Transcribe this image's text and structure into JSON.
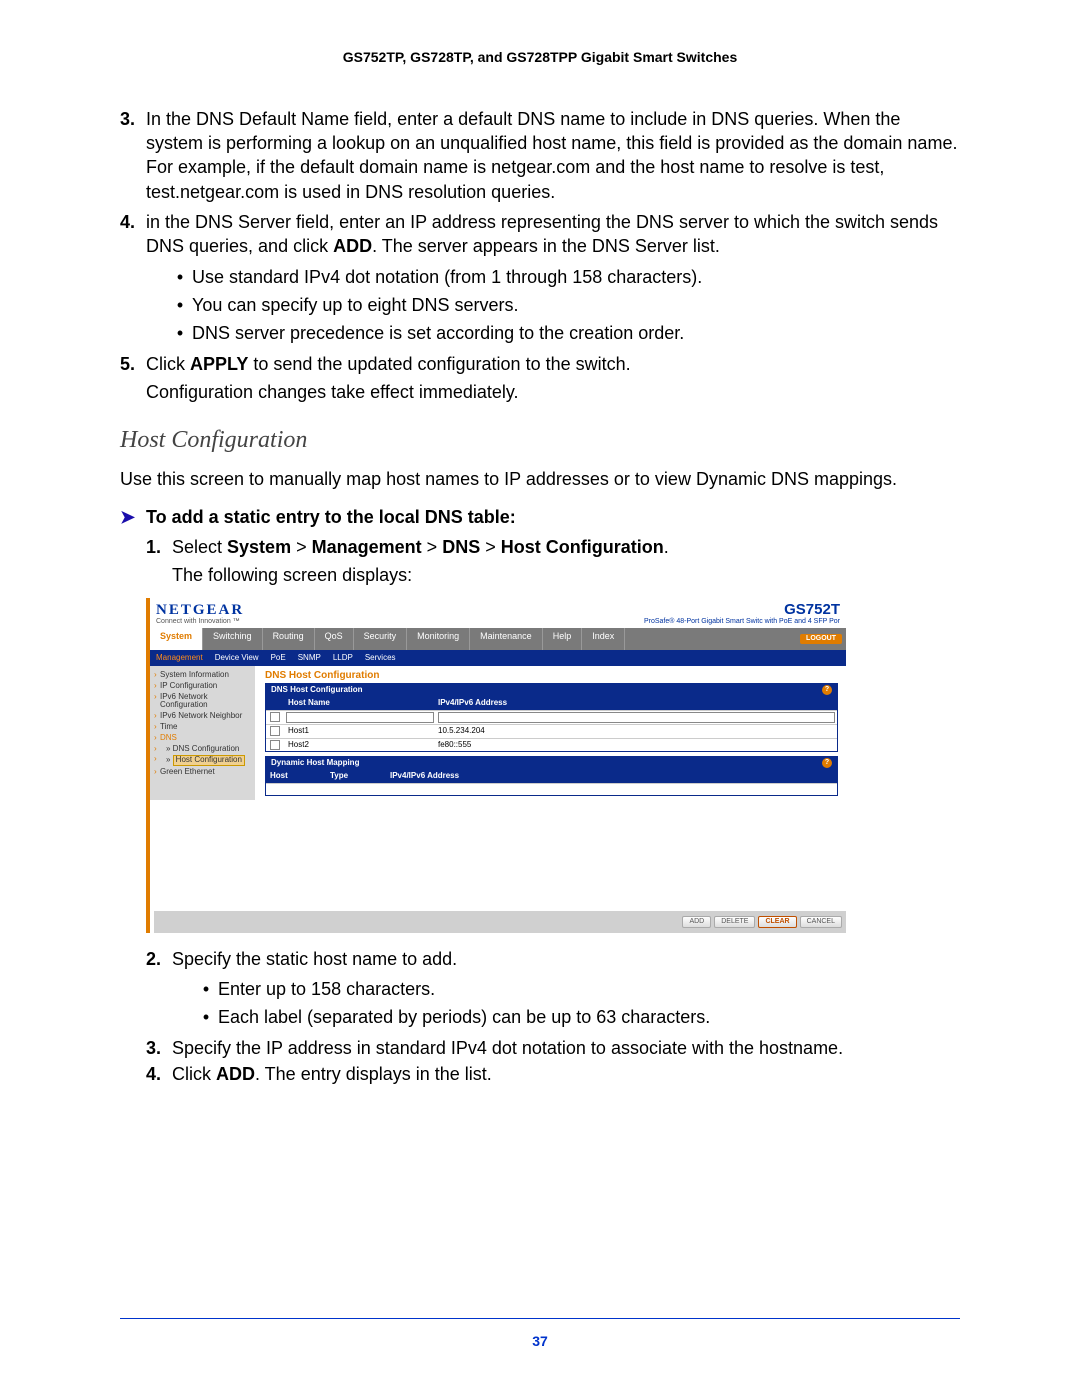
{
  "header": "GS752TP, GS728TP, and GS728TPP Gigabit Smart Switches",
  "step3": {
    "num": "3.",
    "text": "In the DNS Default Name field, enter a default DNS name to include in DNS queries. When the system is performing a lookup on an unqualified host name, this field is provided as the domain name. For example, if the default domain name is netgear.com and the host name to resolve is test, test.netgear.com is used in DNS resolution queries."
  },
  "step4": {
    "num": "4.",
    "pre": "in the DNS Server field, enter an IP address representing the DNS server to which the switch sends DNS queries, and click ",
    "addword": "ADD",
    "post": ". The server appears in the DNS Server list."
  },
  "step4_bullets": [
    "Use standard IPv4 dot notation (from 1 through 158 characters).",
    "You can specify up to eight DNS servers.",
    "DNS server precedence is set according to the creation order."
  ],
  "step5": {
    "num": "5.",
    "pre": "Click ",
    "apply": "APPLY",
    "post": " to send the updated configuration to the switch."
  },
  "step5_cont": "Configuration changes take effect immediately.",
  "section_title": "Host Configuration",
  "section_intro": "Use this screen to manually map host names to IP addresses or to view Dynamic DNS mappings.",
  "proc_head": "To add a static entry to the local DNS table:",
  "s1": {
    "num": "1.",
    "pre": "Select ",
    "path": [
      "System",
      "Management",
      "DNS",
      "Host Configuration"
    ]
  },
  "s1_cont": "The following screen displays:",
  "s2": {
    "num": "2.",
    "text": "Specify the static host name to add."
  },
  "s2_bullets": [
    "Enter up to 158 characters.",
    "Each label (separated by periods) can be up to 63 characters."
  ],
  "s3": {
    "num": "3.",
    "text": "Specify the IP address in standard IPv4 dot notation to associate with the hostname."
  },
  "s4": {
    "num": "4.",
    "pre": "Click ",
    "add": "ADD",
    "post": ". The entry displays in the list."
  },
  "page_number": "37",
  "ss": {
    "logo": "NETGEAR",
    "tagline": "Connect with Innovation ™",
    "model": "GS752T",
    "model_sub": "ProSafe® 48-Port Gigabit Smart Switc\nwith PoE and 4 SFP Por",
    "tabs": [
      "System",
      "Switching",
      "Routing",
      "QoS",
      "Security",
      "Monitoring",
      "Maintenance",
      "Help",
      "Index"
    ],
    "logout": "LOGOUT",
    "subtabs": [
      "Management",
      "Device View",
      "PoE",
      "SNMP",
      "LLDP",
      "Services"
    ],
    "side": [
      "System Information",
      "IP Configuration",
      "IPv6 Network Configuration",
      "IPv6 Network Neighbor",
      "Time",
      "DNS",
      "DNS Configuration",
      "Host Configuration",
      "Green Ethernet"
    ],
    "main_title": "DNS Host Configuration",
    "panel1_title": "DNS Host Configuration",
    "panel1_cols": [
      "Host Name",
      "IPv4/IPv6 Address"
    ],
    "panel1_rows": [
      {
        "host": "Host1",
        "addr": "10.5.234.204"
      },
      {
        "host": "Host2",
        "addr": "fe80::555"
      }
    ],
    "panel2_title": "Dynamic Host Mapping",
    "panel2_cols": [
      "Host",
      "Type",
      "IPv4/IPv6 Address"
    ],
    "bottom_buttons": [
      "ADD",
      "DELETE",
      "CLEAR",
      "CANCEL"
    ]
  }
}
